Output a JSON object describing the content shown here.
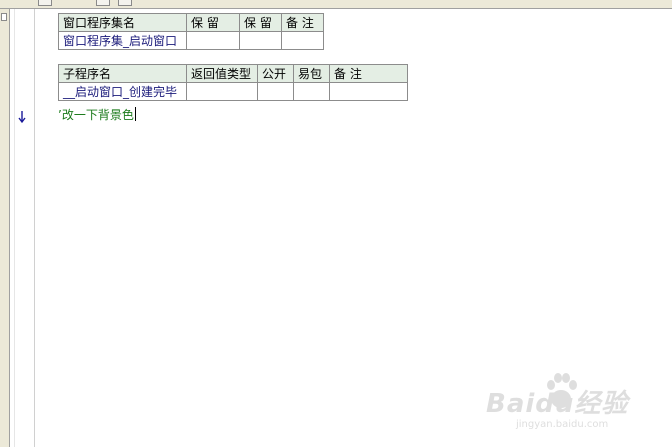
{
  "window_table": {
    "headers": [
      "窗口程序集名",
      "保 留",
      "保 留",
      "备 注"
    ],
    "row": [
      "窗口程序集_启动窗口",
      "",
      "",
      ""
    ]
  },
  "sub_table": {
    "headers": [
      "子程序名",
      "返回值类型",
      "公开",
      "易包",
      "备 注"
    ],
    "row": [
      "__启动窗口_创建完毕",
      "",
      "",
      "",
      ""
    ]
  },
  "code": {
    "line1": "’改一下背景色"
  },
  "watermark": {
    "text": "Baidu经验",
    "url": "jingyan.baidu.com"
  }
}
